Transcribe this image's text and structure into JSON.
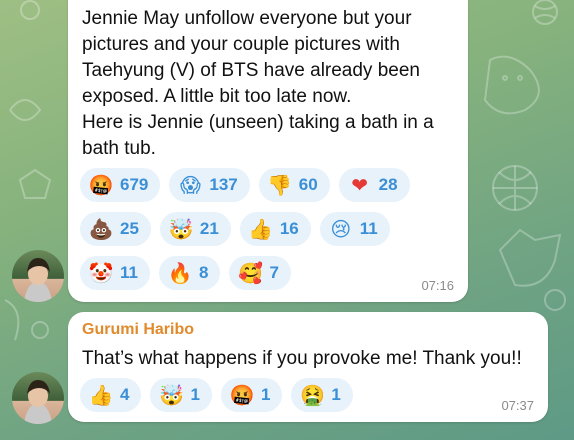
{
  "message1": {
    "text": "Jennie May unfollow everyone but your pictures and your couple pictures with Taehyung (V) of BTS have already been exposed. A little bit too late now.\nHere is Jennie (unseen) taking a bath in a bath tub.",
    "time": "07:16",
    "reactions": [
      [
        {
          "emoji": "🤬",
          "icon": "angry-cursing-face-icon",
          "count": "679"
        },
        {
          "emoji": "😱",
          "icon": "screaming-face-icon",
          "count": "137"
        },
        {
          "emoji": "👎",
          "icon": "thumbs-down-icon",
          "count": "60"
        },
        {
          "emoji": "❤",
          "icon": "heart-icon",
          "count": "28"
        }
      ],
      [
        {
          "emoji": "💩",
          "icon": "poop-icon",
          "count": "25"
        },
        {
          "emoji": "🤯",
          "icon": "exploding-head-icon",
          "count": "21"
        },
        {
          "emoji": "👍",
          "icon": "thumbs-up-icon",
          "count": "16"
        },
        {
          "emoji": "😢",
          "icon": "crying-face-icon",
          "count": "11"
        }
      ],
      [
        {
          "emoji": "🤡",
          "icon": "clown-face-icon",
          "count": "11"
        },
        {
          "emoji": "🔥",
          "icon": "fire-icon",
          "count": "8"
        },
        {
          "emoji": "🥰",
          "icon": "smiling-hearts-face-icon",
          "count": "7"
        }
      ]
    ]
  },
  "message2": {
    "sender": "Gurumi Haribo",
    "text": "That’s what happens if you provoke me! Thank you!!",
    "time": "07:37",
    "reactions": [
      [
        {
          "emoji": "👍",
          "icon": "thumbs-up-icon",
          "count": "4"
        },
        {
          "emoji": "🤯",
          "icon": "exploding-head-icon",
          "count": "1"
        },
        {
          "emoji": "🤬",
          "icon": "angry-cursing-face-icon",
          "count": "1"
        },
        {
          "emoji": "🤮",
          "icon": "vomiting-face-icon",
          "count": "1"
        }
      ]
    ]
  },
  "colors": {
    "sender_name": "#e08a2c",
    "reaction_count": "#3a8fd6",
    "reaction_bg": "#e7f2fb",
    "bubble_bg": "#ffffff"
  }
}
